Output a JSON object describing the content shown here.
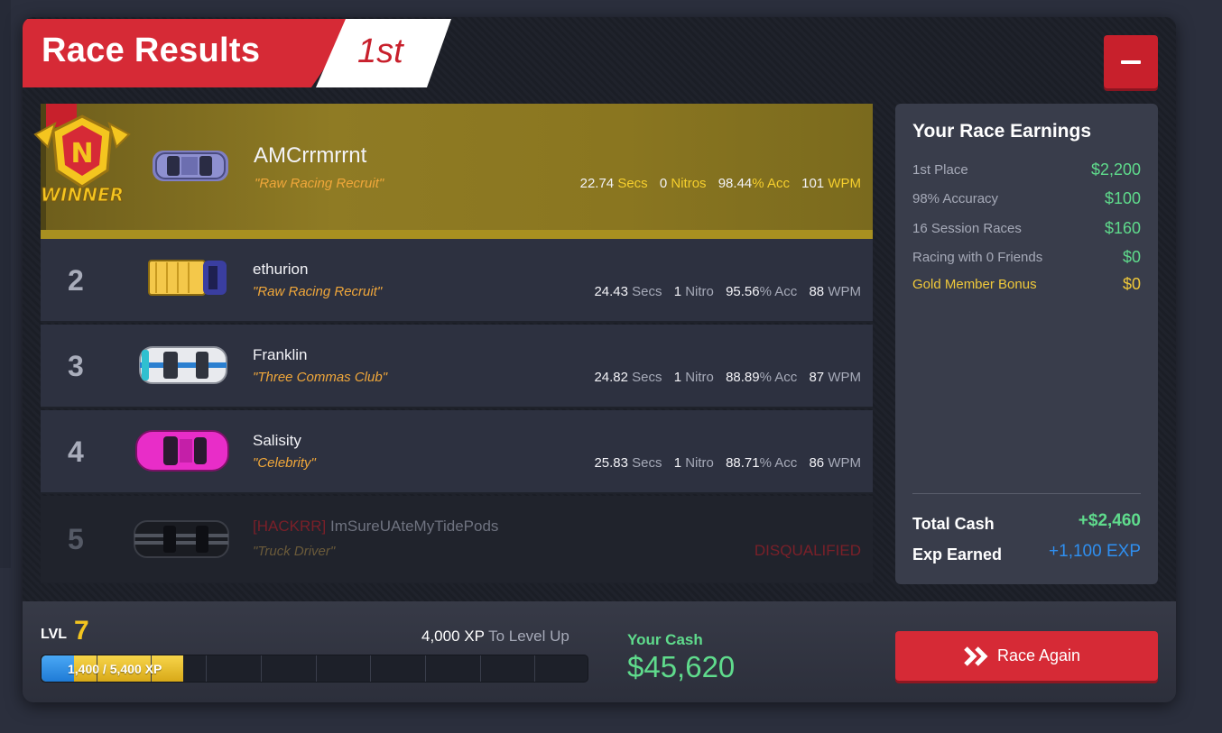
{
  "header": {
    "title": "Race Results",
    "place": "1st"
  },
  "winner_badge_text": "WINNER",
  "racers": [
    {
      "rank": "",
      "name": "AMCrrmrrnt",
      "tag": "",
      "title": "\"Raw Racing Recruit\"",
      "secs": "22.74",
      "secs_label": "Secs",
      "nitros": "0",
      "nitros_label": "Nitros",
      "acc": "98.44",
      "acc_label": "% Acc",
      "wpm": "101",
      "wpm_label": "WPM"
    },
    {
      "rank": "2",
      "name": "ethurion",
      "tag": "",
      "title": "\"Raw Racing Recruit\"",
      "secs": "24.43",
      "secs_label": "Secs",
      "nitros": "1",
      "nitros_label": "Nitro",
      "acc": "95.56",
      "acc_label": "% Acc",
      "wpm": "88",
      "wpm_label": "WPM"
    },
    {
      "rank": "3",
      "name": "Franklin",
      "tag": "",
      "title": "\"Three Commas Club\"",
      "secs": "24.82",
      "secs_label": "Secs",
      "nitros": "1",
      "nitros_label": "Nitro",
      "acc": "88.89",
      "acc_label": "% Acc",
      "wpm": "87",
      "wpm_label": "WPM"
    },
    {
      "rank": "4",
      "name": "Salisity",
      "tag": "",
      "title": "\"Celebrity\"",
      "secs": "25.83",
      "secs_label": "Secs",
      "nitros": "1",
      "nitros_label": "Nitro",
      "acc": "88.71",
      "acc_label": "% Acc",
      "wpm": "86",
      "wpm_label": "WPM"
    },
    {
      "rank": "5",
      "name": "ImSureUAteMyTidePods",
      "tag": "[HACKRR]",
      "title": "\"Truck Driver\"",
      "status": "DISQUALIFIED"
    }
  ],
  "earnings": {
    "title": "Your Race Earnings",
    "items": [
      {
        "label": "1st Place",
        "value": "$2,200"
      },
      {
        "label": "98% Accuracy",
        "value": "$100"
      },
      {
        "label": "16 Session Races",
        "value": "$160"
      },
      {
        "label": "Racing with 0 Friends",
        "value": "$0"
      },
      {
        "label": "Gold Member Bonus",
        "value": "$0"
      }
    ],
    "total_cash_label": "Total Cash",
    "total_cash_value": "+$2,460",
    "exp_label": "Exp Earned",
    "exp_value": "+1,100 EXP"
  },
  "footer": {
    "lvl_label": "LVL",
    "lvl_value": "7",
    "xp_to_next": "4,000 XP",
    "xp_to_next_label": "To Level Up",
    "xp_progress_text": "1,400 / 5,400 XP",
    "xp_progress_fraction": 0.259,
    "cash_label": "Your Cash",
    "cash_value": "$45,620",
    "race_again_label": "Race Again"
  },
  "colors": {
    "accent_red": "#d62a36",
    "money_green": "#5fdb8c",
    "gold": "#f4c51f",
    "exp_blue": "#2f8ff0"
  }
}
